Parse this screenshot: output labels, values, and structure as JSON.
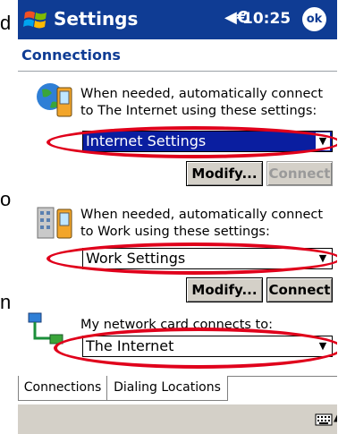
{
  "outside_fragments": {
    "left_letter_1": "d",
    "left_letter_2": "o",
    "left_letter_3": "n"
  },
  "titlebar": {
    "app_title": "Settings",
    "time": "10:25",
    "ok_label": "ok",
    "speaker_glyph": "◀€",
    "start_icon": "windows-flag-icon"
  },
  "section_title": "Connections",
  "group1": {
    "description": "When needed, automatically connect to The Internet using these settings:",
    "dropdown_value": "Internet Settings",
    "modify_label": "Modify...",
    "connect_label": "Connect",
    "connect_enabled": false
  },
  "group2": {
    "description": "When needed, automatically connect to Work using these settings:",
    "dropdown_value": "Work Settings",
    "modify_label": "Modify...",
    "connect_label": "Connect",
    "connect_enabled": true
  },
  "group3": {
    "description": "My network card connects to:",
    "dropdown_value": "The Internet"
  },
  "tabs": [
    {
      "label": "Connections",
      "active": true
    },
    {
      "label": "Dialing Locations",
      "active": false
    }
  ],
  "bottom_bar": {
    "keyboard_icon": "keyboard-icon",
    "arrow_icon": "up-arrow-icon"
  },
  "colors": {
    "title_bar": "#0f3c94",
    "highlight_oval": "#e0001b",
    "selected_dropdown": "#0a1ea0"
  }
}
